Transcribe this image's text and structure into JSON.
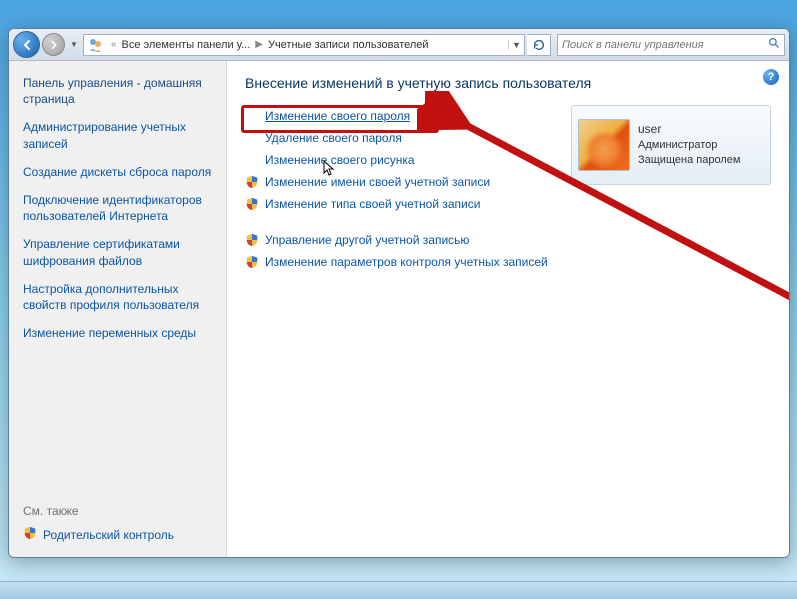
{
  "window_controls": {
    "min": "—",
    "max": "▢",
    "close": "✕"
  },
  "breadcrumb": {
    "seg1": "Все элементы панели у...",
    "seg2": "Учетные записи пользователей"
  },
  "search": {
    "placeholder": "Поиск в панели управления"
  },
  "sidebar": {
    "home": "Панель управления - домашняя страница",
    "tasks": [
      "Администрирование учетных записей",
      "Создание дискеты сброса пароля",
      "Подключение идентификаторов пользователей Интернета",
      "Управление сертификатами шифрования файлов",
      "Настройка дополнительных свойств профиля пользователя",
      "Изменение переменных среды"
    ],
    "seealso_header": "См. также",
    "seealso_item": "Родительский контроль"
  },
  "content": {
    "heading": "Внесение изменений в учетную запись пользователя",
    "actions_plain": [
      "Изменение своего пароля",
      "Удаление своего пароля",
      "Изменение своего рисунка"
    ],
    "actions_shield1": [
      "Изменение имени своей учетной записи",
      "Изменение типа своей учетной записи"
    ],
    "actions_shield2": [
      "Управление другой учетной записью",
      "Изменение параметров контроля учетных записей"
    ]
  },
  "user_card": {
    "name": "user",
    "role": "Администратор",
    "protected": "Защищена паролем"
  }
}
